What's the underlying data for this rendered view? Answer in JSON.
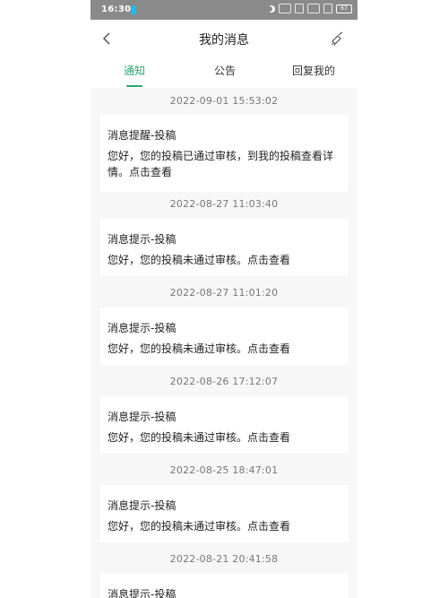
{
  "statusbar": {
    "time": "16:30",
    "battery": "67"
  },
  "nav": {
    "title": "我的消息"
  },
  "tabs": [
    {
      "label": "通知",
      "active": true
    },
    {
      "label": "公告",
      "active": false
    },
    {
      "label": "回复我的",
      "active": false
    }
  ],
  "messages": [
    {
      "timestamp": "2022-09-01 15:53:02",
      "title": "消息提醒-投稿",
      "body": "您好，您的投稿已通过审核，到我的投稿查看详情。点击查看"
    },
    {
      "timestamp": "2022-08-27 11:03:40",
      "title": "消息提示-投稿",
      "body": "您好，您的投稿未通过审核。点击查看"
    },
    {
      "timestamp": "2022-08-27 11:01:20",
      "title": "消息提示-投稿",
      "body": "您好，您的投稿未通过审核。点击查看"
    },
    {
      "timestamp": "2022-08-26 17:12:07",
      "title": "消息提示-投稿",
      "body": "您好，您的投稿未通过审核。点击查看"
    },
    {
      "timestamp": "2022-08-25 18:47:01",
      "title": "消息提示-投稿",
      "body": "您好，您的投稿未通过审核。点击查看"
    },
    {
      "timestamp": "2022-08-21 20:41:58",
      "title": "消息提示-投稿",
      "body": ""
    }
  ],
  "colors": {
    "accent": "#2aa66f",
    "background": "#f7f7f7"
  }
}
